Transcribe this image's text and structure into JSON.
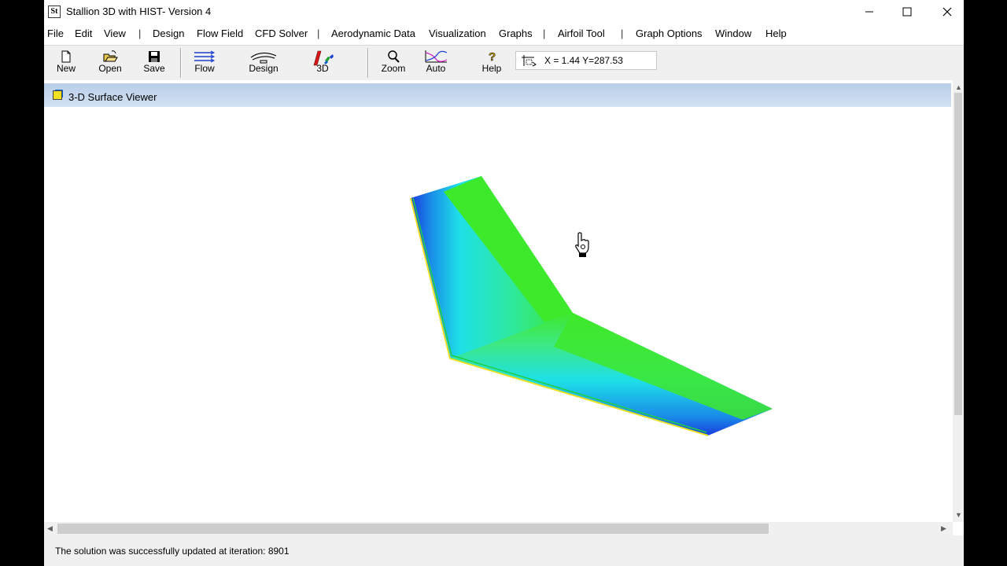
{
  "window": {
    "title": "Stallion 3D with HIST- Version 4",
    "app_icon_glyph": "St"
  },
  "menu": [
    {
      "label": "File"
    },
    {
      "label": "Edit"
    },
    {
      "label": "View"
    },
    {
      "label": "Design"
    },
    {
      "label": "Flow Field"
    },
    {
      "label": "CFD Solver"
    },
    {
      "label": "Aerodynamic Data"
    },
    {
      "label": "Visualization"
    },
    {
      "label": "Graphs"
    },
    {
      "label": "Airfoil Tool"
    },
    {
      "label": "Graph Options"
    },
    {
      "label": "Window"
    },
    {
      "label": "Help"
    }
  ],
  "menu_separator": "|",
  "toolbar": {
    "new_label": "New",
    "open_label": "Open",
    "save_label": "Save",
    "flow_label": "Flow",
    "design_label": "Design",
    "threed_label": "3D",
    "zoom_label": "Zoom",
    "auto_label": "Auto",
    "help_label": "Help",
    "coordinates": "X = 1.44  Y=287.53"
  },
  "viewer": {
    "title": "3-D Surface Viewer"
  },
  "status": {
    "message": "The solution was successfully updated at iteration: 8901"
  },
  "colors": {
    "accent_green": "#3ee82a",
    "accent_cyan": "#1ee0e8",
    "accent_blue": "#1a3ce0",
    "titlebar_gradient": "#c3d6ee"
  },
  "icons": [
    "app-icon",
    "minimize-icon",
    "maximize-icon",
    "close-icon",
    "new-file-icon",
    "open-folder-icon",
    "save-disk-icon",
    "flow-icon",
    "design-airfoil-icon",
    "3d-icon",
    "zoom-magnifier-icon",
    "auto-chart-icon",
    "help-icon",
    "coordinate-icon",
    "hand-cursor-icon"
  ]
}
